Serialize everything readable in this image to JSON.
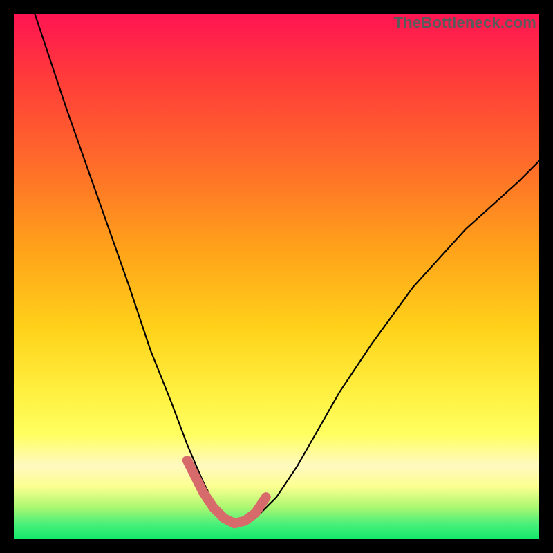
{
  "watermark": "TheBottleneck.com",
  "colors": {
    "gradient_top": "#ff1452",
    "gradient_upper": "#ff6a2a",
    "gradient_mid": "#ffd21a",
    "gradient_lower": "#ffff60",
    "gradient_band": "#fff9c0",
    "gradient_bottom": "#12e86a",
    "curve": "#000000",
    "valley": "#d76a6a",
    "frame": "#000000"
  },
  "gradient_css": "linear-gradient(to bottom, #ff1452 0%, #ff3b3a 12%, #ff6a2a 28%, #ffa31a 45%, #ffd21a 60%, #fff040 72%, #ffff60 80%, #fff9c0 86%, #fbff90 90%, #a9f770 94%, #4cf07a 97%, #12e86a 100%)",
  "chart_data": {
    "type": "line",
    "title": "",
    "xlabel": "",
    "ylabel": "",
    "xlim": [
      0,
      100
    ],
    "ylim": [
      0,
      100
    ],
    "series": [
      {
        "name": "bottleneck-curve",
        "x": [
          4,
          10,
          16,
          22,
          26,
          30,
          33,
          36,
          38,
          40,
          42,
          44,
          46,
          50,
          54,
          58,
          62,
          68,
          76,
          86,
          96,
          100
        ],
        "y": [
          100,
          82,
          65,
          48,
          36,
          26,
          18,
          11,
          7,
          4,
          3,
          3,
          4,
          8,
          14,
          21,
          28,
          37,
          48,
          59,
          68,
          72
        ]
      }
    ],
    "highlight": {
      "name": "valley-band",
      "x": [
        33,
        36,
        38,
        40,
        42,
        44,
        46,
        48
      ],
      "y": [
        15,
        9,
        6,
        4,
        3,
        3.5,
        5,
        8
      ]
    }
  }
}
